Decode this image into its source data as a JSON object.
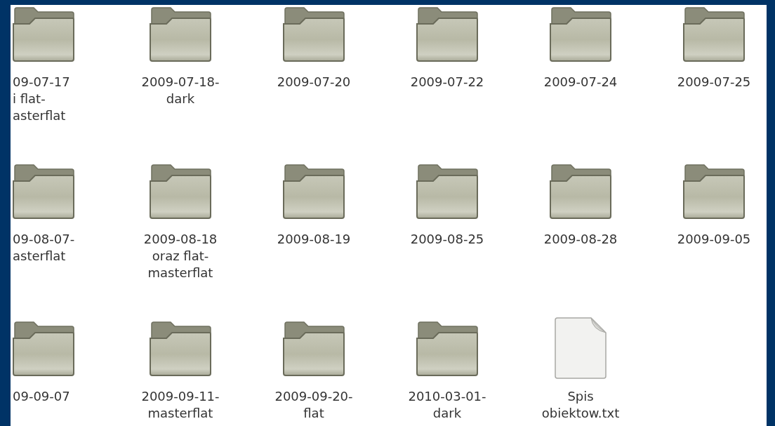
{
  "rows": [
    [
      {
        "kind": "folder",
        "label": [
          "09-07-17",
          "i flat-",
          "asterflat"
        ]
      },
      {
        "kind": "folder",
        "label": [
          "2009-07-18-",
          "dark"
        ]
      },
      {
        "kind": "folder",
        "label": [
          "2009-07-20"
        ]
      },
      {
        "kind": "folder",
        "label": [
          "2009-07-22"
        ]
      },
      {
        "kind": "folder",
        "label": [
          "2009-07-24"
        ]
      },
      {
        "kind": "folder",
        "label": [
          "2009-07-25"
        ]
      }
    ],
    [
      {
        "kind": "folder",
        "label": [
          "09-08-07-",
          "asterflat"
        ]
      },
      {
        "kind": "folder",
        "label": [
          "2009-08-18",
          "oraz flat-",
          "masterflat"
        ]
      },
      {
        "kind": "folder",
        "label": [
          "2009-08-19"
        ]
      },
      {
        "kind": "folder",
        "label": [
          "2009-08-25"
        ]
      },
      {
        "kind": "folder",
        "label": [
          "2009-08-28"
        ]
      },
      {
        "kind": "folder",
        "label": [
          "2009-09-05"
        ]
      }
    ],
    [
      {
        "kind": "folder",
        "label": [
          "09-09-07"
        ]
      },
      {
        "kind": "folder",
        "label": [
          "2009-09-11-",
          "masterflat"
        ]
      },
      {
        "kind": "folder",
        "label": [
          "2009-09-20-",
          "flat"
        ]
      },
      {
        "kind": "folder",
        "label": [
          "2010-03-01-",
          "dark"
        ]
      },
      {
        "kind": "file",
        "label": [
          "Spis",
          "obiektow.txt"
        ]
      }
    ]
  ]
}
